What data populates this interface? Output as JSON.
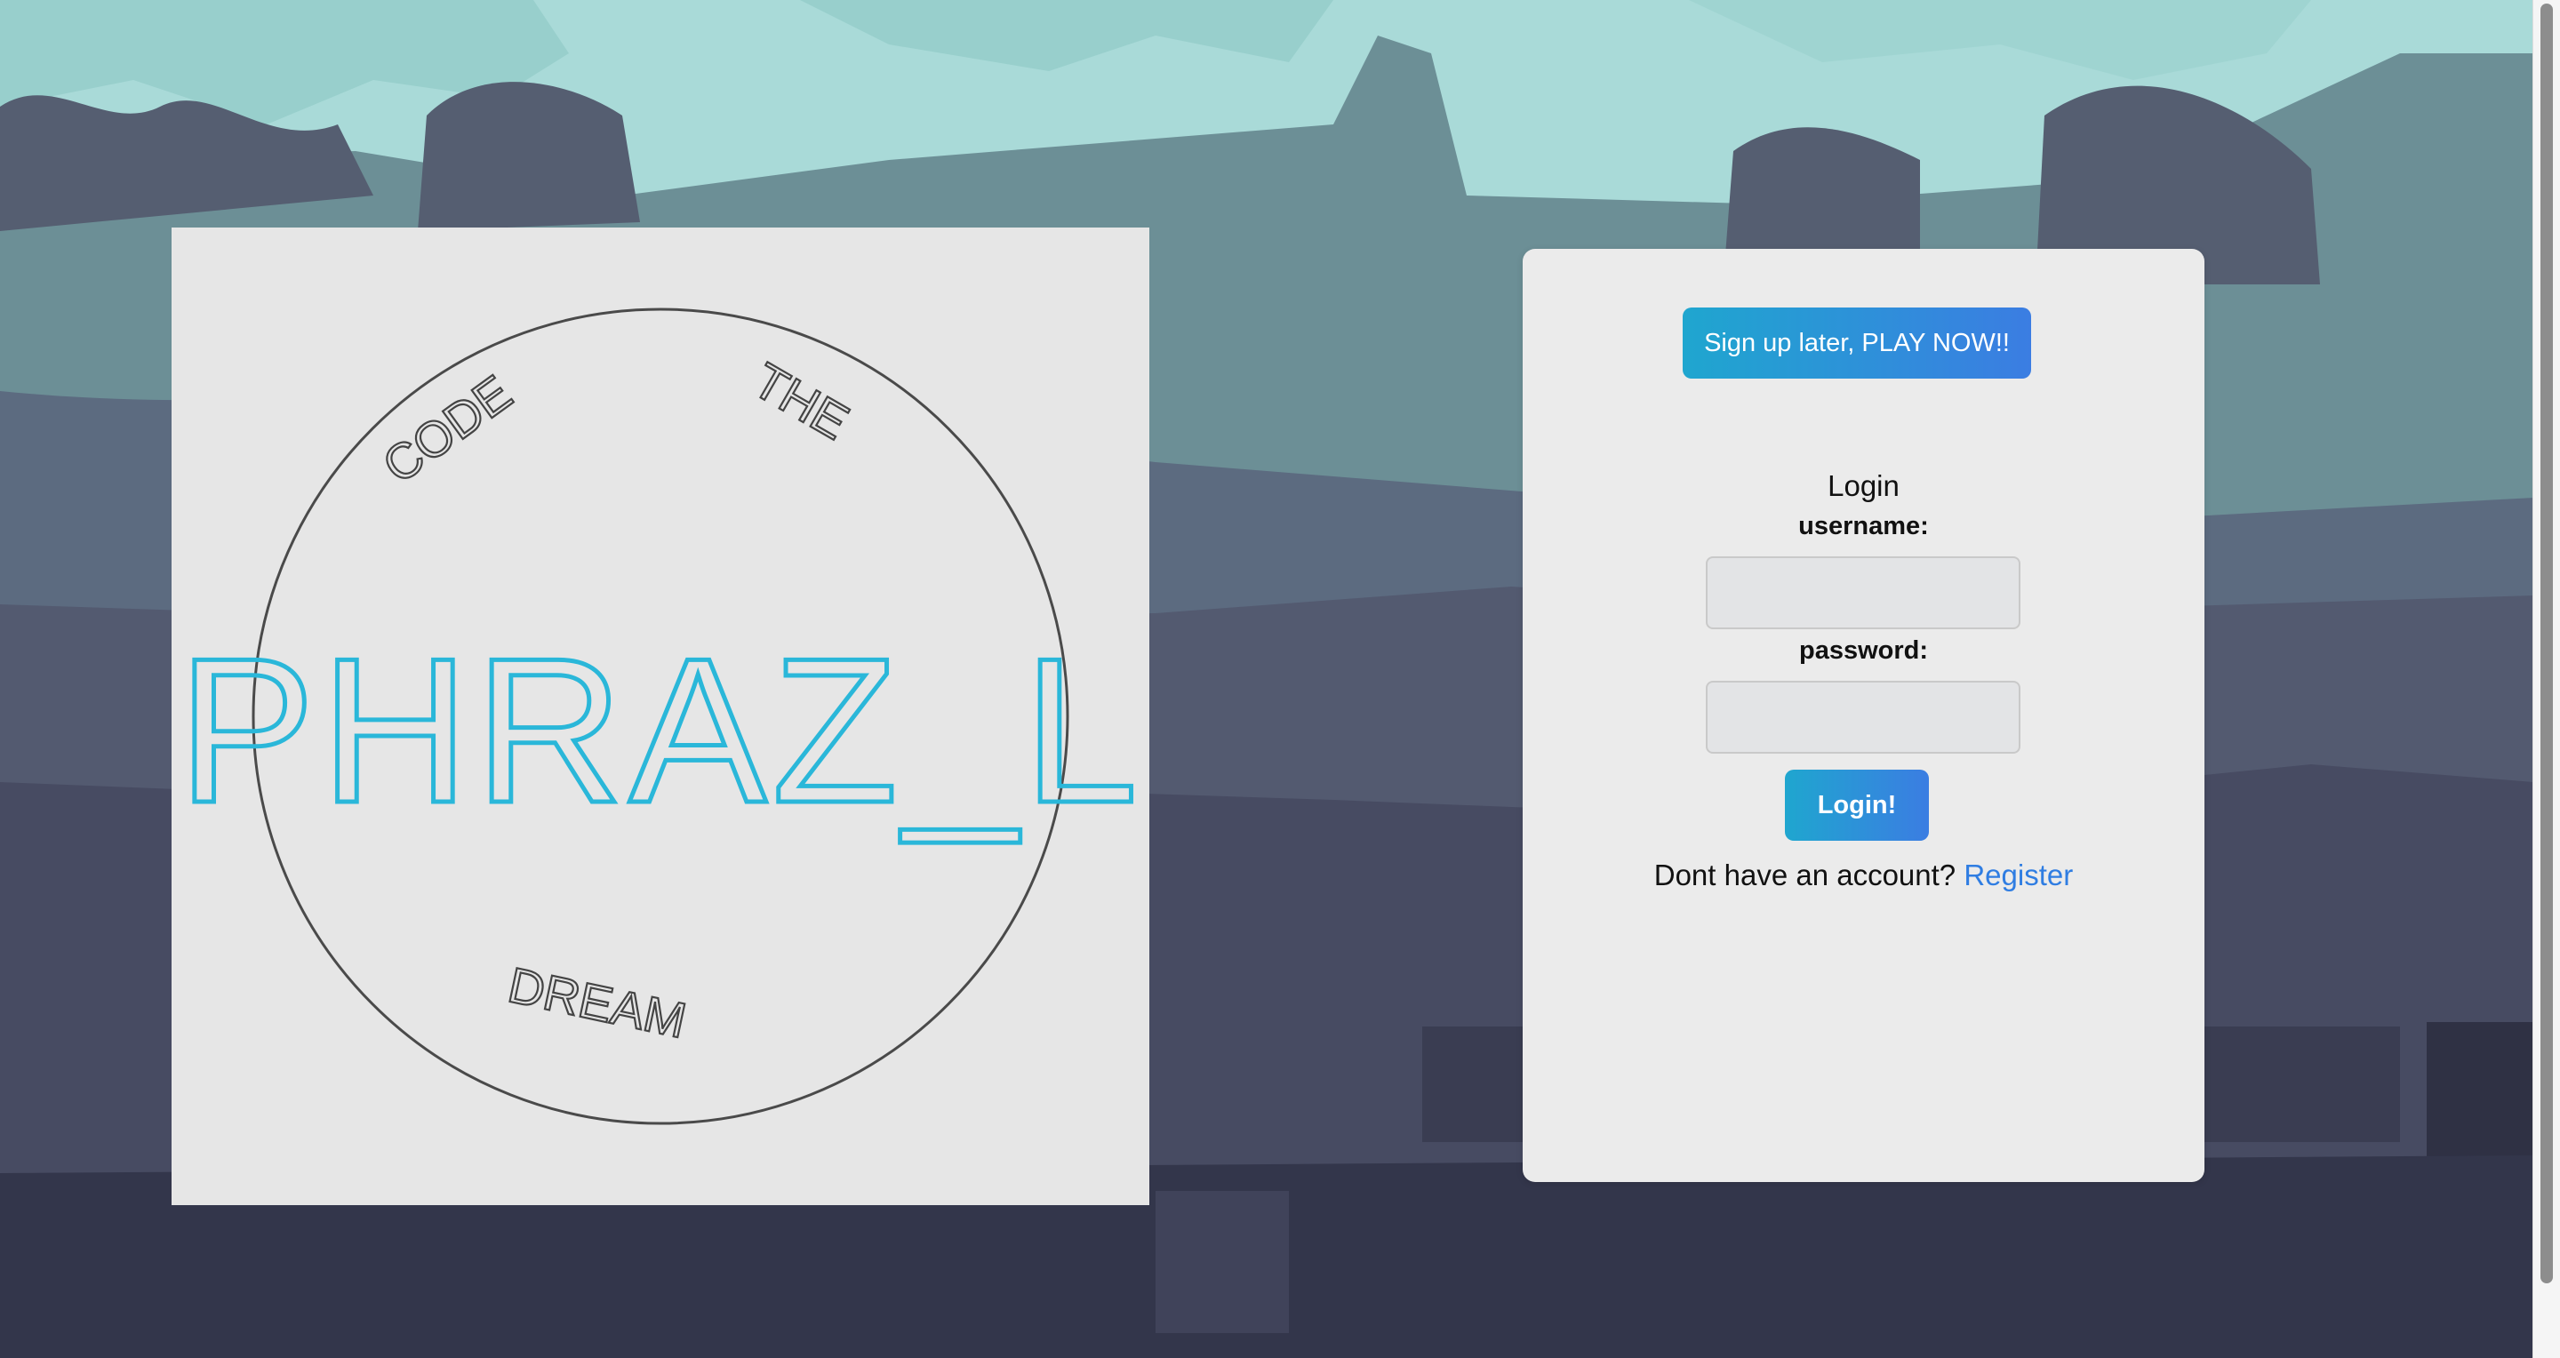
{
  "logo": {
    "brand": "PHRAZ_L",
    "arc_top_left": "CODE",
    "arc_top_right": "THE",
    "arc_bottom": "DREAM"
  },
  "login_card": {
    "play_now_label": "Sign up later, PLAY NOW!!",
    "title": "Login",
    "username_label": "username:",
    "password_label": "password:",
    "username_value": "",
    "password_value": "",
    "login_button_label": "Login!",
    "register_prompt": "Dont have an account? ",
    "register_link": "Register"
  },
  "colors": {
    "accent_start": "#1fa6cf",
    "accent_end": "#3b7de2",
    "logo_cyan": "#2ab7d9",
    "link": "#2f7de2"
  }
}
